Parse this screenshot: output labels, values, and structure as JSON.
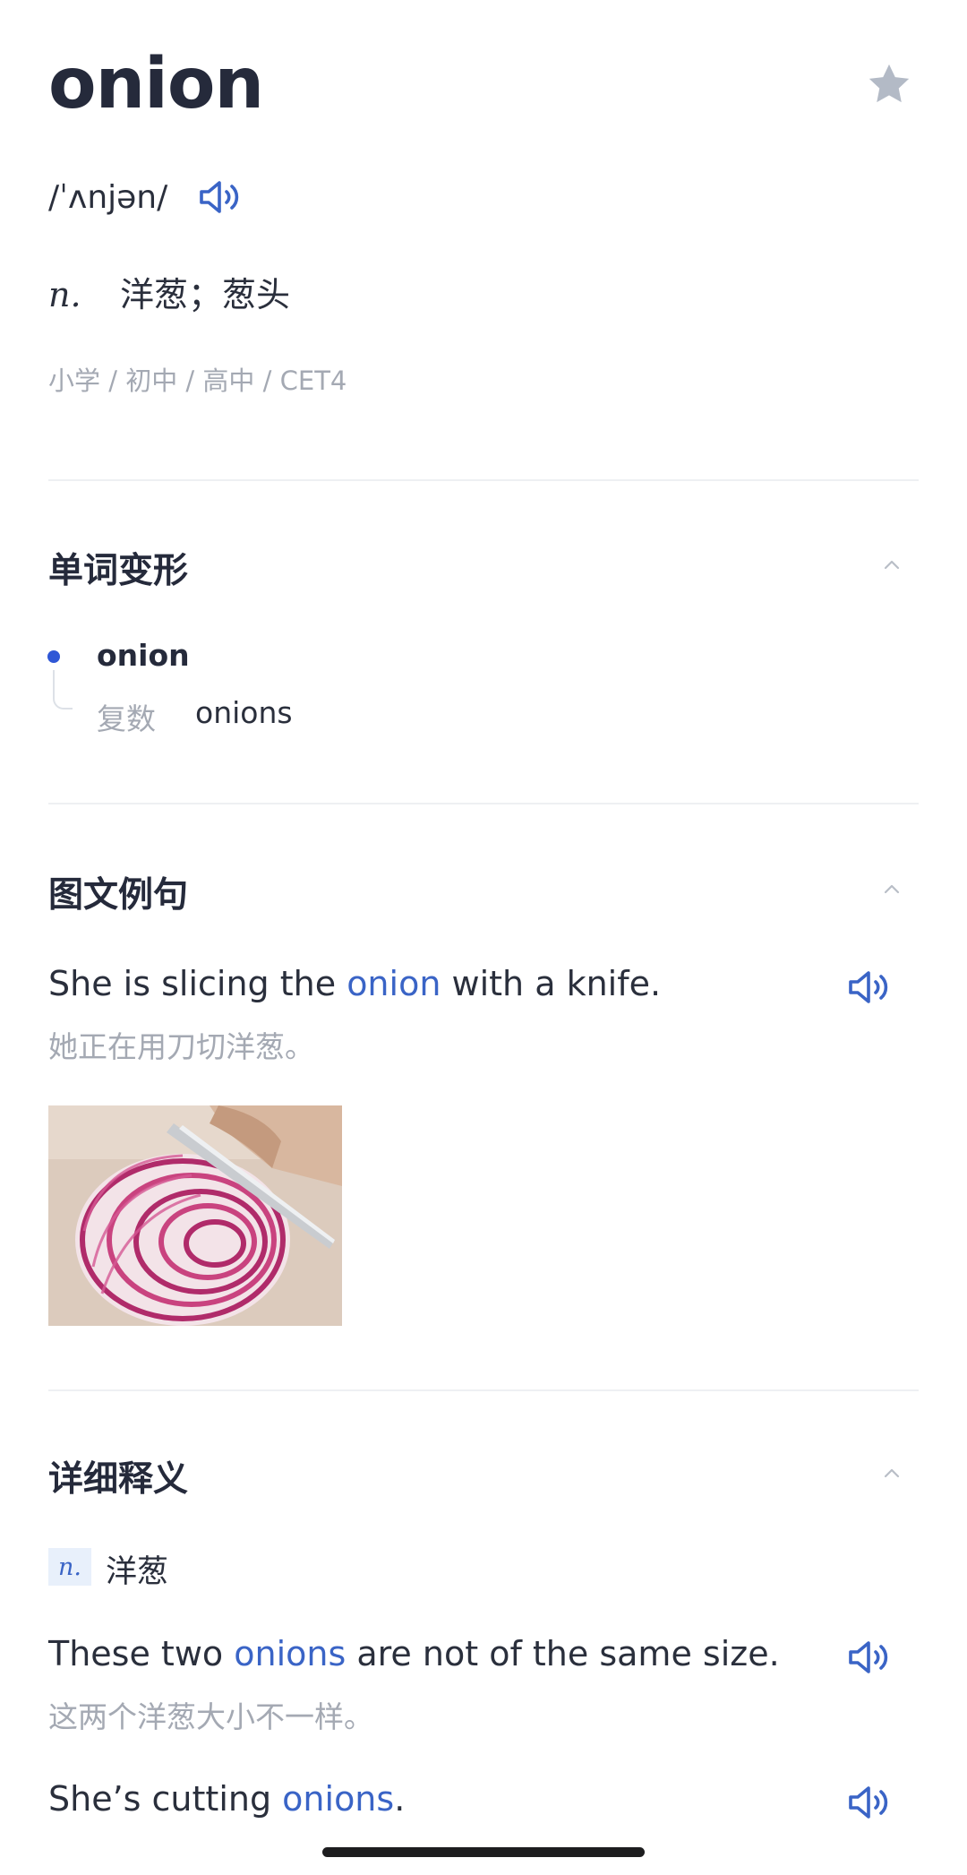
{
  "header": {
    "word": "onion",
    "phonetic": "/ˈʌnjən/",
    "definition_pos": "n.",
    "definition": "洋葱；葱头",
    "levels": "小学 / 初中 / 高中 / CET4"
  },
  "sections": {
    "forms_title": "单词变形",
    "examples_title": "图文例句",
    "detail_title": "详细释义"
  },
  "forms": {
    "base": "onion",
    "plural_label": "复数",
    "plural_value": "onions"
  },
  "picture_example": {
    "en_before": "She is slicing the ",
    "en_highlight": "onion",
    "en_after": " with a knife.",
    "cn": "她正在用刀切洋葱。"
  },
  "detail": {
    "pos": "n.",
    "meaning": "洋葱",
    "examples": [
      {
        "en_before": "These two ",
        "en_highlight": "onions",
        "en_after": " are not of the same size.",
        "cn": "这两个洋葱大小不一样。"
      },
      {
        "en_before": "She’s cutting ",
        "en_highlight": "onions",
        "en_after": "."
      }
    ]
  },
  "icons": {
    "favorite": "star-icon",
    "audio": "speaker-icon",
    "collapse": "chevron-up-icon"
  },
  "colors": {
    "accent": "#3a64c6",
    "bullet": "#2f57d6",
    "muted_text": "#a4a9b3",
    "star": "#b3bac6"
  }
}
